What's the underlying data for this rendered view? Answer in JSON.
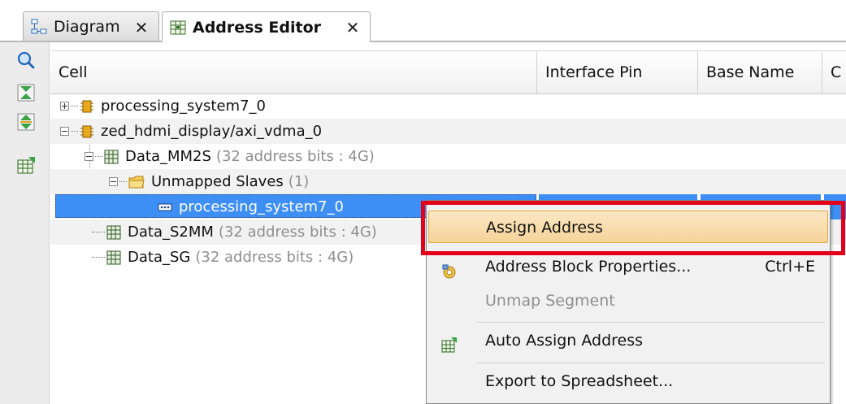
{
  "tabs": [
    {
      "label": "Diagram",
      "close": "✕",
      "active": false
    },
    {
      "label": "Address Editor",
      "close": "✕",
      "active": true
    }
  ],
  "toolbar": {
    "buttons": [
      "search-icon",
      "collapse-all-icon",
      "expand-all-icon",
      "auto-assign-icon"
    ]
  },
  "table": {
    "columns": [
      "Cell",
      "Interface Pin",
      "Base Name",
      "C"
    ],
    "rows": [
      {
        "label": "processing_system7_0",
        "suffix": "",
        "level": 0,
        "expander": "plus",
        "icon": "ip-block-icon"
      },
      {
        "label": "zed_hdmi_display/axi_vdma_0",
        "suffix": "",
        "level": 0,
        "expander": "minus",
        "icon": "ip-block-icon"
      },
      {
        "label": "Data_MM2S",
        "suffix": "(32 address bits : 4G)",
        "level": 1,
        "expander": "minus",
        "icon": "address-space-icon"
      },
      {
        "label": "Unmapped Slaves",
        "suffix": "(1)",
        "level": 2,
        "expander": "minus",
        "icon": "folder-icon"
      },
      {
        "label": "processing_system7_0",
        "suffix": "",
        "level": 3,
        "expander": "",
        "icon": "segment-icon",
        "selected": true
      },
      {
        "label": "Data_S2MM",
        "suffix": "(32 address bits : 4G)",
        "level": 1,
        "expander": "",
        "icon": "address-space-icon"
      },
      {
        "label": "Data_SG",
        "suffix": "(32 address bits : 4G)",
        "level": 1,
        "expander": "",
        "icon": "address-space-icon"
      }
    ]
  },
  "context_menu": {
    "items": [
      {
        "label": "Assign Address",
        "shortcut": "",
        "state": "hover",
        "icon": ""
      },
      {
        "label": "Address Block Properties...",
        "shortcut": "Ctrl+E",
        "state": "normal",
        "icon": "properties-icon"
      },
      {
        "label": "Unmap Segment",
        "shortcut": "",
        "state": "disabled",
        "icon": ""
      },
      {
        "label": "Auto Assign Address",
        "shortcut": "",
        "state": "normal",
        "icon": "auto-assign-icon"
      },
      {
        "label": "Export to Spreadsheet...",
        "shortcut": "",
        "state": "normal",
        "icon": ""
      }
    ]
  },
  "colors": {
    "selection": "#3d8ef5",
    "menu_hover": "#f6d399",
    "highlight_box": "#e2001a"
  }
}
